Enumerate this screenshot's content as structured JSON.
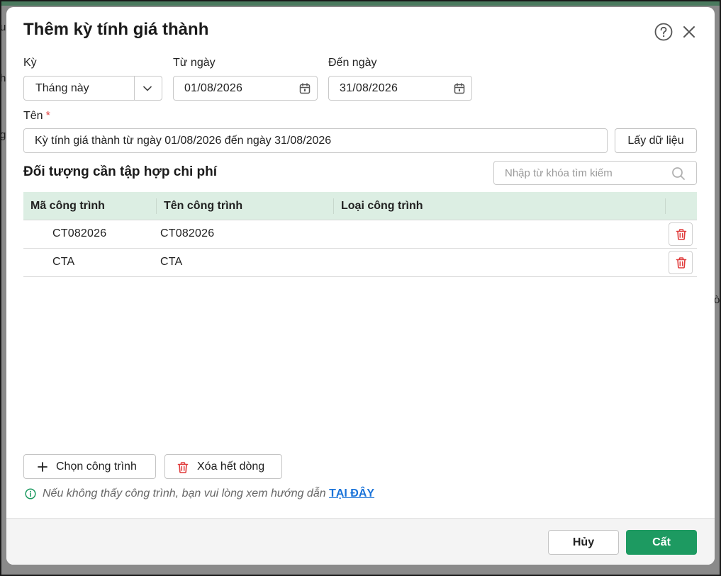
{
  "background": {
    "fragments": [
      "u",
      "h",
      "g",
      "ò"
    ]
  },
  "dialog": {
    "title": "Thêm kỳ tính giá thành"
  },
  "period": {
    "label": "Kỳ",
    "value": "Tháng này"
  },
  "from_date": {
    "label": "Từ ngày",
    "value": "01/08/2026"
  },
  "to_date": {
    "label": "Đến ngày",
    "value": "31/08/2026"
  },
  "name": {
    "label": "Tên",
    "required_mark": "*",
    "value": "Kỳ tính giá thành từ ngày 01/08/2026 đến ngày 31/08/2026"
  },
  "fetch_button": "Lấy dữ liệu",
  "section": {
    "title": "Đối tượng cần tập hợp chi phí",
    "search_placeholder": "Nhập từ khóa tìm kiếm"
  },
  "table": {
    "headers": [
      "Mã công trình",
      "Tên công trình",
      "Loại công trình"
    ],
    "rows": [
      {
        "code": "CT082026",
        "name": "CT082026",
        "type": ""
      },
      {
        "code": "CTA",
        "name": "CTA",
        "type": ""
      }
    ]
  },
  "actions": {
    "choose_label": "Chọn công trình",
    "clear_label": "Xóa hết dòng"
  },
  "hint": {
    "text": "Nếu không thấy công trình, bạn vui lòng xem hướng dẫn",
    "link": "TẠI ĐÂY"
  },
  "footer": {
    "cancel_label": "Hủy",
    "save_label": "Cất"
  },
  "colors": {
    "primary": "#1d9a61",
    "header_bg": "#dceee3",
    "danger": "#e03b3b",
    "link": "#1a73d9"
  }
}
